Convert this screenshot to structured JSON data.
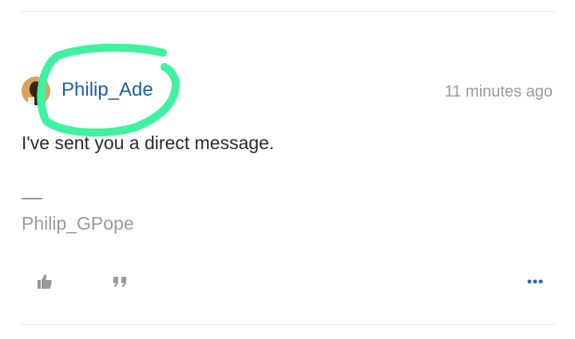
{
  "post": {
    "author": "Philip_Ade",
    "timestamp": "11 minutes ago",
    "message": "I've sent you a direct message.",
    "signature": "Philip_GPope"
  },
  "actions": {
    "like_icon": "thumbs-up-icon",
    "quote_icon": "quote-icon",
    "more_icon": "ellipsis-icon"
  },
  "colors": {
    "author_link": "#1f5f9e",
    "highlight_marker": "#3ef2a0",
    "muted_text": "#9a9a9a",
    "more_icon": "#2a66b8"
  }
}
